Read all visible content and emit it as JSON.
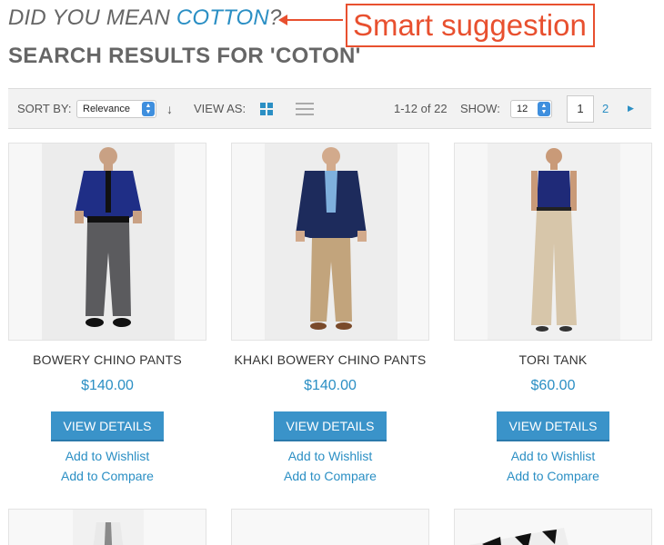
{
  "suggestion": {
    "prefix": "DID YOU MEAN ",
    "term": "COTTON",
    "suffix": "?",
    "annotation": "Smart suggestion"
  },
  "results_title": "SEARCH RESULTS FOR 'COTON'",
  "toolbar": {
    "sort_label": "SORT BY:",
    "sort_value": "Relevance",
    "view_label": "VIEW AS:",
    "count_text": "1-12 of 22",
    "show_label": "SHOW:",
    "show_value": "12",
    "current_page": "1",
    "next_page": "2"
  },
  "products": [
    {
      "name": "BOWERY CHINO PANTS",
      "price": "$140.00",
      "button": "VIEW DETAILS",
      "wishlist": "Add to Wishlist",
      "compare": "Add to Compare"
    },
    {
      "name": "KHAKI BOWERY CHINO PANTS",
      "price": "$140.00",
      "button": "VIEW DETAILS",
      "wishlist": "Add to Wishlist",
      "compare": "Add to Compare"
    },
    {
      "name": "TORI TANK",
      "price": "$60.00",
      "button": "VIEW DETAILS",
      "wishlist": "Add to Wishlist",
      "compare": "Add to Compare"
    }
  ],
  "colors": {
    "accent": "#2b8fc4",
    "button": "#3a93c9",
    "annotation": "#e8502f"
  }
}
